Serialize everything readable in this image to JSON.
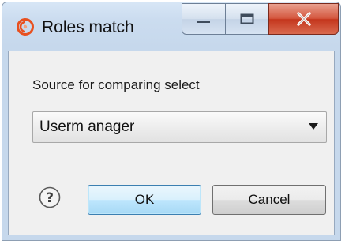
{
  "window": {
    "title": "Roles match",
    "title_icon": "app-logo-icon",
    "caption_buttons": [
      "minimize-icon",
      "maximize-icon",
      "close-icon"
    ]
  },
  "form": {
    "prompt": "Source for comparing select",
    "source_select": {
      "value": "Userm anager"
    }
  },
  "actions": {
    "help_icon": "help-icon",
    "ok_label": "OK",
    "cancel_label": "Cancel"
  },
  "colors": {
    "close_button": "#c4361d",
    "logo": "#e8501f",
    "ok_border": "#3c7fb1"
  }
}
